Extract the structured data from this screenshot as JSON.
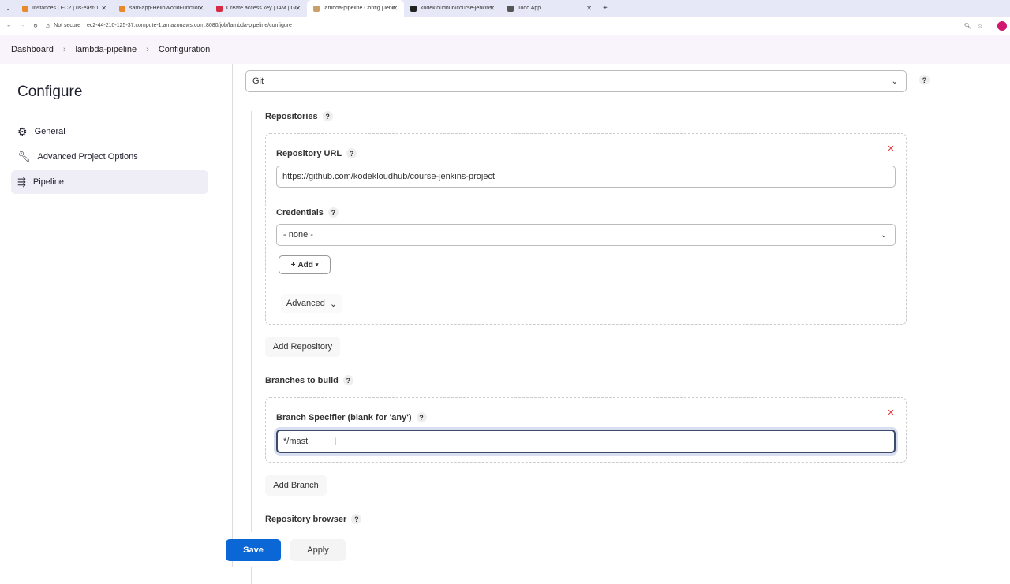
{
  "browser": {
    "tabs": [
      {
        "title": "Instances | EC2 | us-east-1",
        "color": "#e8892b"
      },
      {
        "title": "sam-app-HelloWorldFunction-",
        "color": "#e8892b"
      },
      {
        "title": "Create access key | IAM | Global",
        "color": "#d62b45"
      },
      {
        "title": "lambda-pipeline Config [Jenkins]",
        "color": "#c9a06a",
        "active": true
      },
      {
        "title": "kodekloudhub/course-jenkins-",
        "color": "#222"
      },
      {
        "title": "Todo App",
        "color": "#555"
      }
    ],
    "security": "Not secure",
    "url": "ec2-44-210-125-37.compute-1.amazonaws.com:8080/job/lambda-pipeline/configure"
  },
  "breadcrumb": [
    "Dashboard",
    "lambda-pipeline",
    "Configuration"
  ],
  "sidebar": {
    "title": "Configure",
    "items": [
      {
        "label": "General",
        "icon": "gear-icon"
      },
      {
        "label": "Advanced Project Options",
        "icon": "wrench-icon"
      },
      {
        "label": "Pipeline",
        "icon": "pipeline-icon",
        "active": true
      }
    ]
  },
  "scm": {
    "value": "Git"
  },
  "repositories": {
    "label": "Repositories",
    "url_label": "Repository URL",
    "url_value": "https://github.com/kodekloudhub/course-jenkins-project",
    "credentials_label": "Credentials",
    "credentials_value": "- none -",
    "add_label": "Add",
    "advanced_label": "Advanced",
    "add_repo_label": "Add Repository"
  },
  "branches": {
    "label": "Branches to build",
    "specifier_label": "Branch Specifier (blank for 'any')",
    "specifier_value": "*/mast",
    "add_branch_label": "Add Branch"
  },
  "repo_browser": {
    "label": "Repository browser"
  },
  "footer": {
    "save": "Save",
    "apply": "Apply"
  },
  "help_glyph": "?"
}
